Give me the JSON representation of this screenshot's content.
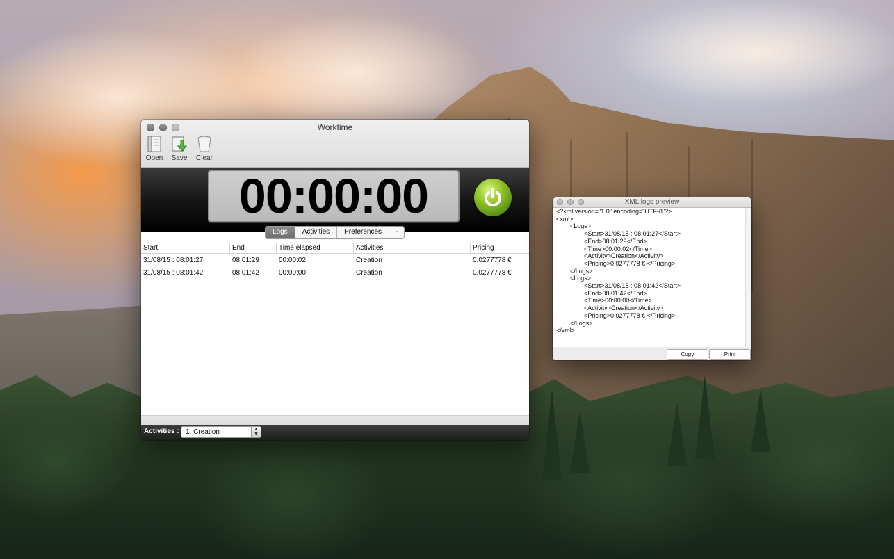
{
  "worktime_window": {
    "title": "Worktime",
    "toolbar": {
      "open_label": "Open",
      "save_label": "Save",
      "clear_label": "Clear"
    },
    "timer": "00:00:00",
    "tabs": [
      "Logs",
      "Activities",
      "Preferences",
      "-"
    ],
    "active_tab": "Logs",
    "table": {
      "columns": [
        "Start",
        "End",
        "Time elapsed",
        "Activities",
        "Pricing"
      ],
      "rows": [
        [
          "31/08/15 : 08:01:27",
          "08:01:29",
          "00:00:02",
          "Creation",
          "0.0277778 €"
        ],
        [
          "31/08/15 : 08:01:42",
          "08:01:42",
          "00:00:00",
          "Creation",
          "0.0277778 €"
        ]
      ]
    },
    "bottom_bar": {
      "activities_label": "Activities :",
      "selected_activity": "1. Creation"
    },
    "colors": {
      "power_button": "#8fc227",
      "timer_band": "#000000"
    }
  },
  "xml_window": {
    "title": "XML logs preview",
    "lines": [
      "<?xml version=\"1.0\" encoding=\"UTF-8\"?>",
      "<xml>",
      "        <Logs>",
      "                <Start>31/08/15 : 08:01:27</Start>",
      "                <End>08:01:29</End>",
      "                <Time>00:00:02</Time>",
      "                <Activity>Creation</Activity>",
      "                <Pricing>0.0277778 € </Pricing>",
      "        </Logs>",
      "        <Logs>",
      "                <Start>31/08/15 : 08:01:42</Start>",
      "                <End>08:01:42</End>",
      "                <Time>00:00:00</Time>",
      "                <Activity>Creation</Activity>",
      "                <Pricing>0.0277778 € </Pricing>",
      "        </Logs>",
      "</xml>"
    ],
    "buttons": {
      "copy_label": "Copy",
      "print_label": "Print"
    }
  }
}
